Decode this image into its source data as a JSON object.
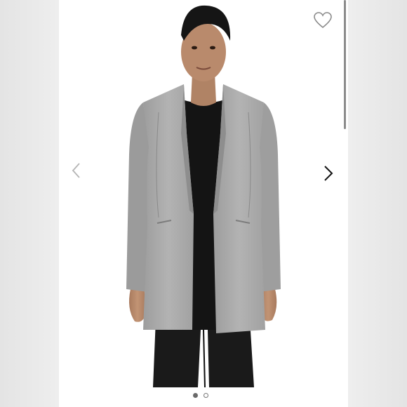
{
  "product_image": {
    "alt": "",
    "active_index": 0,
    "total_images": 2
  },
  "icons": {
    "favorite": "heart-outline-icon",
    "previous": "chevron-left-icon",
    "next": "chevron-right-icon"
  },
  "colors": {
    "blazer": "#a8a8a8",
    "top": "#141414",
    "pants": "#1a1a1a",
    "skin": "#b98a6c",
    "hair": "#151515",
    "background": "#ffffff"
  }
}
